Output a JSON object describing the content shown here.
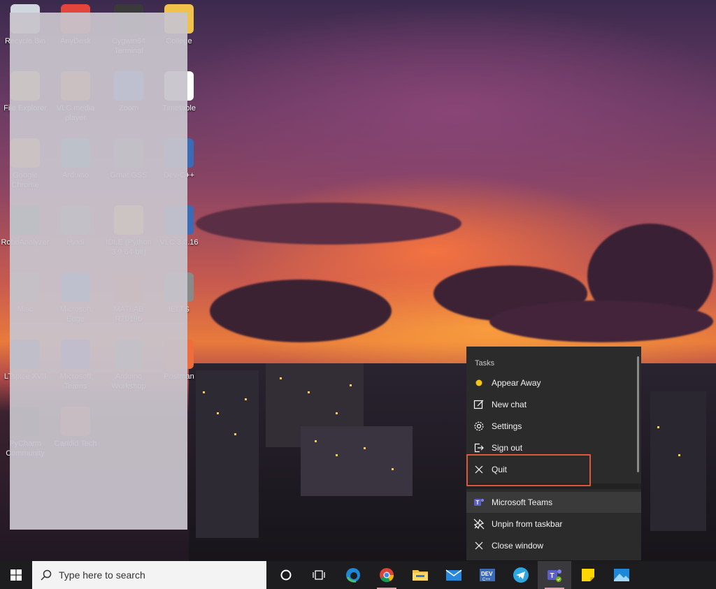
{
  "desktop": {
    "icons": [
      {
        "label": "Recycle Bin",
        "color": "#cfd6de"
      },
      {
        "label": "AnyDesk",
        "color": "#e2453c"
      },
      {
        "label": "Cygwin64 Terminal",
        "color": "#3a3a3a"
      },
      {
        "label": "College",
        "color": "#f0c24b"
      },
      {
        "label": "File Explorer",
        "color": "#f0c24b"
      },
      {
        "label": "VLC media player",
        "color": "#f08c1c"
      },
      {
        "label": "Zoom",
        "color": "#2d8cff"
      },
      {
        "label": "Timetable",
        "color": "#ffffff"
      },
      {
        "label": "Google Chrome",
        "color": "#e3a33a"
      },
      {
        "label": "Arduino",
        "color": "#17a2a8"
      },
      {
        "label": "Gmat GSS",
        "color": "#7a7a7a"
      },
      {
        "label": "Dev-C++",
        "color": "#3b6bb8"
      },
      {
        "label": "RoboAnalyzer",
        "color": "#2b7a4b"
      },
      {
        "label": "Hindi",
        "color": "#8a8a8a"
      },
      {
        "label": "IDLE (Python 3.9 64-bit)",
        "color": "#f2c230"
      },
      {
        "label": "VLC 3.0.16",
        "color": "#3b6bb8"
      },
      {
        "label": "Misc",
        "color": "#9a8a6a"
      },
      {
        "label": "Microsoft Edge",
        "color": "#2b8ad8"
      },
      {
        "label": "MATLAB R2019b",
        "color": "#d55a2a"
      },
      {
        "label": "IELTS",
        "color": "#8a8a8a"
      },
      {
        "label": "LTspice XVII",
        "color": "#4a6a9a"
      },
      {
        "label": "Microsoft Teams",
        "color": "#5058c8"
      },
      {
        "label": "Arduino Workshop",
        "color": "#8a8a8a"
      },
      {
        "label": "Postman",
        "color": "#ef6c3c"
      },
      {
        "label": "PyCharm Community",
        "color": "#1a1a1a"
      },
      {
        "label": "Candid Tech",
        "color": "#c84a3a"
      }
    ]
  },
  "jumplist": {
    "header": "Tasks",
    "tasks": [
      {
        "label": "Appear Away",
        "icon": "status-dot-icon"
      },
      {
        "label": "New chat",
        "icon": "compose-icon"
      },
      {
        "label": "Settings",
        "icon": "gear-icon"
      },
      {
        "label": "Sign out",
        "icon": "sign-out-icon"
      },
      {
        "label": "Quit",
        "icon": "close-icon"
      }
    ],
    "pinned_app": "Microsoft Teams",
    "actions": [
      {
        "label": "Unpin from taskbar",
        "icon": "unpin-icon"
      },
      {
        "label": "Close window",
        "icon": "close-icon"
      }
    ],
    "colors": {
      "away_dot": "#f5c518",
      "highlight": "#e0563a",
      "teams": "#5b5fc7"
    }
  },
  "taskbar": {
    "search_placeholder": "Type here to search",
    "apps": [
      {
        "name": "cortana",
        "icon": "cortana-icon"
      },
      {
        "name": "task-view",
        "icon": "task-view-icon"
      },
      {
        "name": "edge",
        "icon": "edge-icon"
      },
      {
        "name": "chrome",
        "icon": "chrome-icon"
      },
      {
        "name": "file-explorer",
        "icon": "folder-icon"
      },
      {
        "name": "mail",
        "icon": "mail-icon"
      },
      {
        "name": "dev-cpp",
        "icon": "dev-cpp-icon"
      },
      {
        "name": "telegram",
        "icon": "telegram-icon"
      },
      {
        "name": "teams",
        "icon": "teams-icon"
      },
      {
        "name": "sticky-notes",
        "icon": "sticky-notes-icon"
      },
      {
        "name": "photos",
        "icon": "photos-icon"
      }
    ]
  }
}
